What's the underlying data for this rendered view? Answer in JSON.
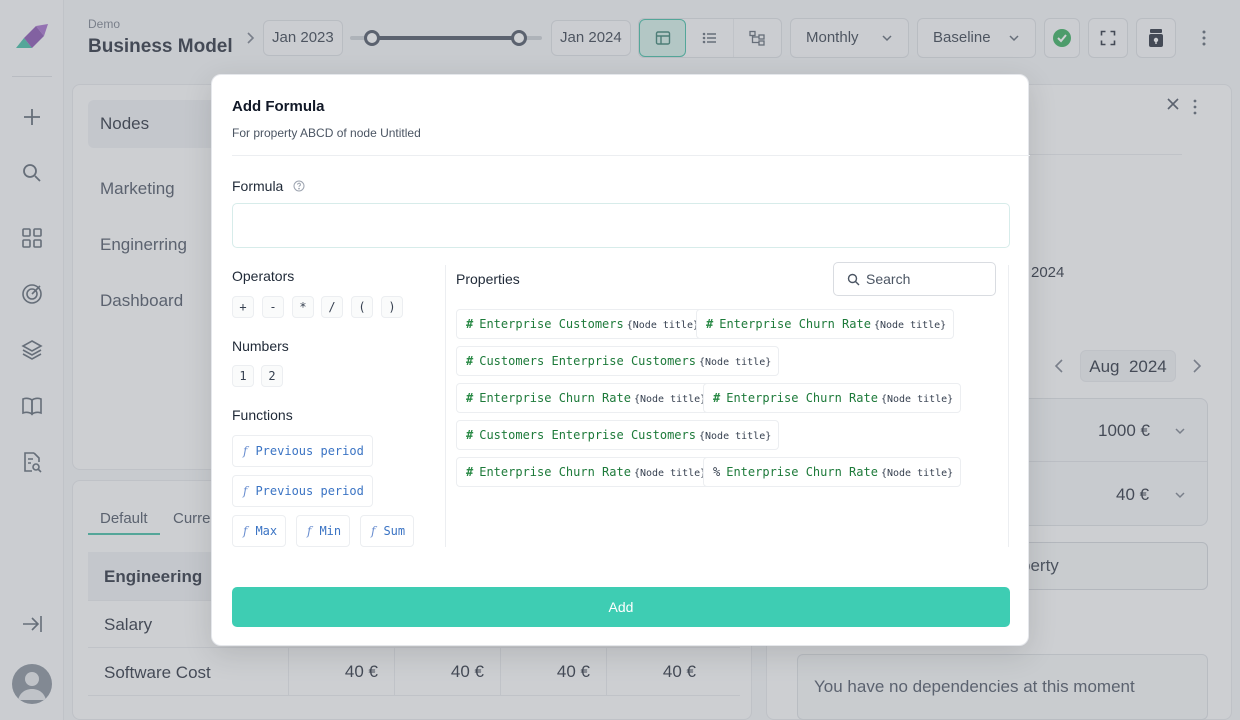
{
  "header": {
    "breadcrumb_small": "Demo",
    "title": "Business Model",
    "date_start": "Jan 2023",
    "date_end": "Jan 2024",
    "period_select": "Monthly",
    "scenario_select": "Baseline"
  },
  "nodes_panel": {
    "selected": "Nodes",
    "items": [
      "Marketing",
      "Enginerring",
      "Dashboard"
    ]
  },
  "table": {
    "tabs": [
      "Default",
      "Curre"
    ],
    "group_label": "Engineering",
    "rows": [
      {
        "label": "Salary"
      },
      {
        "label": "Software Cost",
        "values": [
          "40 €",
          "40 €",
          "40 €",
          "40 €"
        ]
      }
    ]
  },
  "right_panel": {
    "partial_year": "2024",
    "month": "Aug",
    "year": "2024",
    "value_1": "1000 €",
    "value_2": "40 €",
    "property_button": "perty",
    "deps_message": "You have no dependencies at this moment"
  },
  "modal": {
    "title": "Add Formula",
    "subtitle": "For property ABCD of node Untitled",
    "formula_label": "Formula",
    "formula_value": "",
    "operators_label": "Operators",
    "operators": [
      "+",
      "-",
      "*",
      "/",
      "(",
      ")"
    ],
    "numbers_label": "Numbers",
    "numbers": [
      "1",
      "2"
    ],
    "functions_label": "Functions",
    "functions": [
      "Previous period",
      "Previous period",
      "Max",
      "Min",
      "Sum"
    ],
    "properties_label": "Properties",
    "search_placeholder": "Search",
    "node_title_tag": "{Node title}",
    "properties": [
      {
        "icon": "#",
        "name": "Enterprise Customers"
      },
      {
        "icon": "#",
        "name": "Enterprise Churn Rate"
      },
      {
        "icon": "#",
        "name": "Customers Enterprise Customers"
      },
      {
        "icon": "#",
        "name": "Enterprise Churn Rate"
      },
      {
        "icon": "#",
        "name": "Enterprise Churn Rate"
      },
      {
        "icon": "#",
        "name": "Customers Enterprise Customers"
      },
      {
        "icon": "#",
        "name": "Enterprise Churn Rate"
      },
      {
        "icon": "%",
        "name": "Enterprise Churn Rate"
      }
    ],
    "add_button": "Add"
  },
  "colors": {
    "accent": "#3ecdb3",
    "property_text": "#1d7a3a",
    "function_text": "#3b74c4"
  }
}
